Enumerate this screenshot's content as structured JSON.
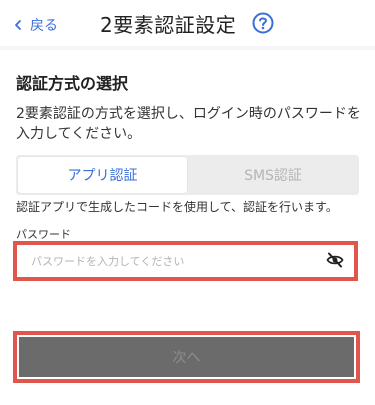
{
  "header": {
    "back_label": "戻る",
    "title": "2要素認証設定",
    "help_icon": "question-circle-icon"
  },
  "section": {
    "title": "認証方式の選択",
    "description": "2要素認証の方式を選択し、ログイン時のパスワードを入力してください。"
  },
  "tabs": [
    {
      "label": "アプリ認証",
      "active": true
    },
    {
      "label": "SMS認証",
      "active": false
    }
  ],
  "method_description": "認証アプリで生成したコードを使用して、認証を行います。",
  "password": {
    "label": "パスワード",
    "placeholder": "パスワードを入力してください",
    "value": "",
    "toggle_icon": "eye-slash-icon"
  },
  "next_button": {
    "label": "次へ",
    "enabled": false
  },
  "colors": {
    "accent": "#3b6fd8",
    "highlight": "#e0564a",
    "disabled_button": "#6b6b6b"
  }
}
